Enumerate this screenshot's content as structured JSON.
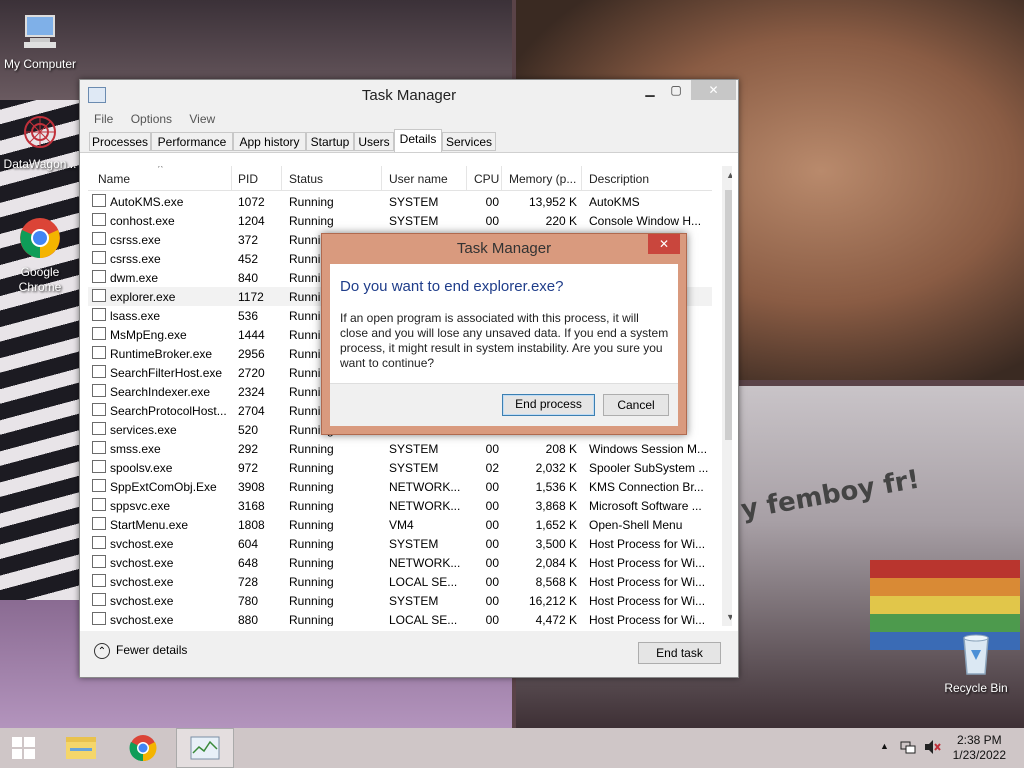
{
  "desktop": {
    "icons": [
      {
        "label": "My Computer"
      },
      {
        "label": "DataWagon..."
      },
      {
        "label": "Google Chrome"
      },
      {
        "label": "Recycle Bin"
      }
    ],
    "wallpaper_text": "y femboy fr!"
  },
  "task_manager": {
    "title": "Task Manager",
    "menu": [
      "File",
      "Options",
      "View"
    ],
    "tabs": [
      "Processes",
      "Performance",
      "App history",
      "Startup",
      "Users",
      "Details",
      "Services"
    ],
    "active_tab": "Details",
    "columns": [
      "Name",
      "PID",
      "Status",
      "User name",
      "CPU",
      "Memory (p...",
      "Description"
    ],
    "rows": [
      {
        "name": "AutoKMS.exe",
        "pid": "1072",
        "status": "Running",
        "user": "SYSTEM",
        "cpu": "00",
        "mem": "13,952 K",
        "desc": "AutoKMS"
      },
      {
        "name": "conhost.exe",
        "pid": "1204",
        "status": "Running",
        "user": "SYSTEM",
        "cpu": "00",
        "mem": "220 K",
        "desc": "Console Window H..."
      },
      {
        "name": "csrss.exe",
        "pid": "372",
        "status": "Runnin",
        "user": "",
        "cpu": "",
        "mem": "",
        "desc": "m..."
      },
      {
        "name": "csrss.exe",
        "pid": "452",
        "status": "Runnin",
        "user": "",
        "cpu": "",
        "mem": "",
        "desc": "m..."
      },
      {
        "name": "dwm.exe",
        "pid": "840",
        "status": "Runnin",
        "user": "",
        "cpu": "",
        "mem": "",
        "desc": "m..."
      },
      {
        "name": "explorer.exe",
        "pid": "1172",
        "status": "Runnin",
        "user": "",
        "cpu": "",
        "mem": "",
        "desc": ""
      },
      {
        "name": "lsass.exe",
        "pid": "536",
        "status": "Runnin",
        "user": "",
        "cpu": "",
        "mem": "",
        "desc": ""
      },
      {
        "name": "MsMpEng.exe",
        "pid": "1444",
        "status": "Runnin",
        "user": "",
        "cpu": "",
        "mem": "",
        "desc": "e..."
      },
      {
        "name": "RuntimeBroker.exe",
        "pid": "2956",
        "status": "Runnin",
        "user": "",
        "cpu": "",
        "mem": "",
        "desc": ""
      },
      {
        "name": "SearchFilterHost.exe",
        "pid": "2720",
        "status": "Runnin",
        "user": "",
        "cpu": "",
        "mem": "",
        "desc": "s"
      },
      {
        "name": "SearchIndexer.exe",
        "pid": "2324",
        "status": "Runnin",
        "user": "",
        "cpu": "",
        "mem": "",
        "desc": "s"
      },
      {
        "name": "SearchProtocolHost...",
        "pid": "2704",
        "status": "Runnin",
        "user": "",
        "cpu": "",
        "mem": "",
        "desc": "s"
      },
      {
        "name": "services.exe",
        "pid": "520",
        "status": "Running",
        "user": "",
        "cpu": "",
        "mem": "",
        "desc": "m..."
      },
      {
        "name": "smss.exe",
        "pid": "292",
        "status": "Running",
        "user": "SYSTEM",
        "cpu": "00",
        "mem": "208 K",
        "desc": "Windows Session M..."
      },
      {
        "name": "spoolsv.exe",
        "pid": "972",
        "status": "Running",
        "user": "SYSTEM",
        "cpu": "02",
        "mem": "2,032 K",
        "desc": "Spooler SubSystem ..."
      },
      {
        "name": "SppExtComObj.Exe",
        "pid": "3908",
        "status": "Running",
        "user": "NETWORK...",
        "cpu": "00",
        "mem": "1,536 K",
        "desc": "KMS Connection Br..."
      },
      {
        "name": "sppsvc.exe",
        "pid": "3168",
        "status": "Running",
        "user": "NETWORK...",
        "cpu": "00",
        "mem": "3,868 K",
        "desc": "Microsoft Software ..."
      },
      {
        "name": "StartMenu.exe",
        "pid": "1808",
        "status": "Running",
        "user": "VM4",
        "cpu": "00",
        "mem": "1,652 K",
        "desc": "Open-Shell Menu"
      },
      {
        "name": "svchost.exe",
        "pid": "604",
        "status": "Running",
        "user": "SYSTEM",
        "cpu": "00",
        "mem": "3,500 K",
        "desc": "Host Process for Wi..."
      },
      {
        "name": "svchost.exe",
        "pid": "648",
        "status": "Running",
        "user": "NETWORK...",
        "cpu": "00",
        "mem": "2,084 K",
        "desc": "Host Process for Wi..."
      },
      {
        "name": "svchost.exe",
        "pid": "728",
        "status": "Running",
        "user": "LOCAL SE...",
        "cpu": "00",
        "mem": "8,568 K",
        "desc": "Host Process for Wi..."
      },
      {
        "name": "svchost.exe",
        "pid": "780",
        "status": "Running",
        "user": "SYSTEM",
        "cpu": "00",
        "mem": "16,212 K",
        "desc": "Host Process for Wi..."
      },
      {
        "name": "svchost.exe",
        "pid": "880",
        "status": "Running",
        "user": "LOCAL SE...",
        "cpu": "00",
        "mem": "4,472 K",
        "desc": "Host Process for Wi..."
      }
    ],
    "fewer_details": "Fewer details",
    "end_task": "End task"
  },
  "dialog": {
    "title": "Task Manager",
    "close_glyph": "✕",
    "question": "Do you want to end explorer.exe?",
    "message": "If an open program is associated with this process, it will close and you will lose any unsaved data. If you end a system process, it might result in system instability. Are you sure you want to continue?",
    "end_process": "End process",
    "cancel": "Cancel"
  },
  "taskbar": {
    "time": "2:38 PM",
    "date": "1/23/2022"
  },
  "colors": {
    "dialog_frame": "#d99a7e",
    "dialog_close": "#c9463d",
    "dialog_heading": "#1f3d8a",
    "selected_row": "#f2f2f2",
    "taskbar": "#cfc6c7"
  }
}
